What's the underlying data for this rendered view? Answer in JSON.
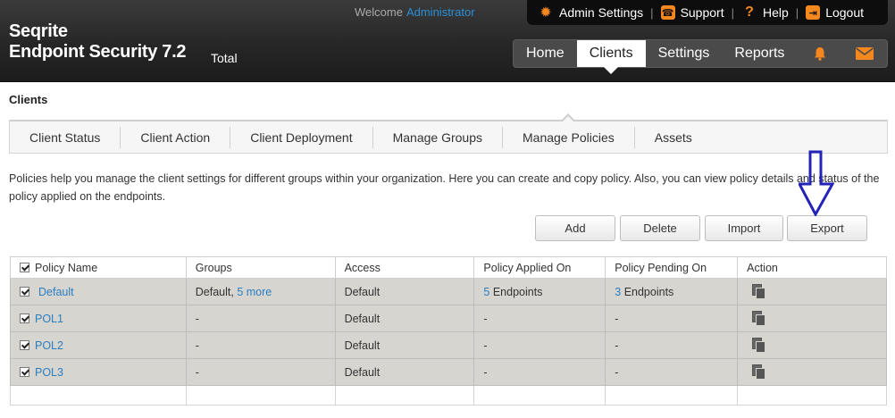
{
  "header": {
    "brand_line1": "Seqrite",
    "brand_line2": "Endpoint Security 7.2",
    "edition": "Total",
    "welcome_label": "Welcome",
    "welcome_user": "Administrator",
    "topbar": {
      "admin_settings": "Admin Settings",
      "support": "Support",
      "help": "Help",
      "logout": "Logout"
    },
    "nav": {
      "home": "Home",
      "clients": "Clients",
      "settings": "Settings",
      "reports": "Reports"
    },
    "icons": [
      "gear-icon",
      "support-icon",
      "help-icon",
      "logout-icon",
      "bell-icon",
      "mail-icon"
    ],
    "accent_color": "#f5871f"
  },
  "page_title": "Clients",
  "subnav": {
    "client_status": "Client Status",
    "client_action": "Client Action",
    "client_deployment": "Client Deployment",
    "manage_groups": "Manage Groups",
    "manage_policies": "Manage Policies",
    "assets": "Assets"
  },
  "description": "Policies help you manage the client settings for different groups within your organization. Here you can create and copy policy. Also, you can view policy details and status of the policy applied on the endpoints.",
  "buttons": {
    "add": "Add",
    "delete": "Delete",
    "import": "Import",
    "export": "Export"
  },
  "table": {
    "columns": {
      "policy_name": "Policy Name",
      "groups": "Groups",
      "access": "Access",
      "applied_on": "Policy Applied On",
      "pending_on": "Policy Pending On",
      "action": "Action"
    },
    "rows": [
      {
        "name": "Default",
        "groups_prefix": "Default, ",
        "groups_more": "5 more",
        "access": "Default",
        "applied_count": "5",
        "applied_suffix": " Endpoints",
        "pending_count": "3",
        "pending_suffix": " Endpoints"
      },
      {
        "name": "POL1",
        "groups": "-",
        "access": "Default",
        "applied": "-",
        "pending": "-"
      },
      {
        "name": "POL2",
        "groups": "-",
        "access": "Default",
        "applied": "-",
        "pending": "-"
      },
      {
        "name": "POL3",
        "groups": "-",
        "access": "Default",
        "applied": "-",
        "pending": "-"
      }
    ]
  }
}
